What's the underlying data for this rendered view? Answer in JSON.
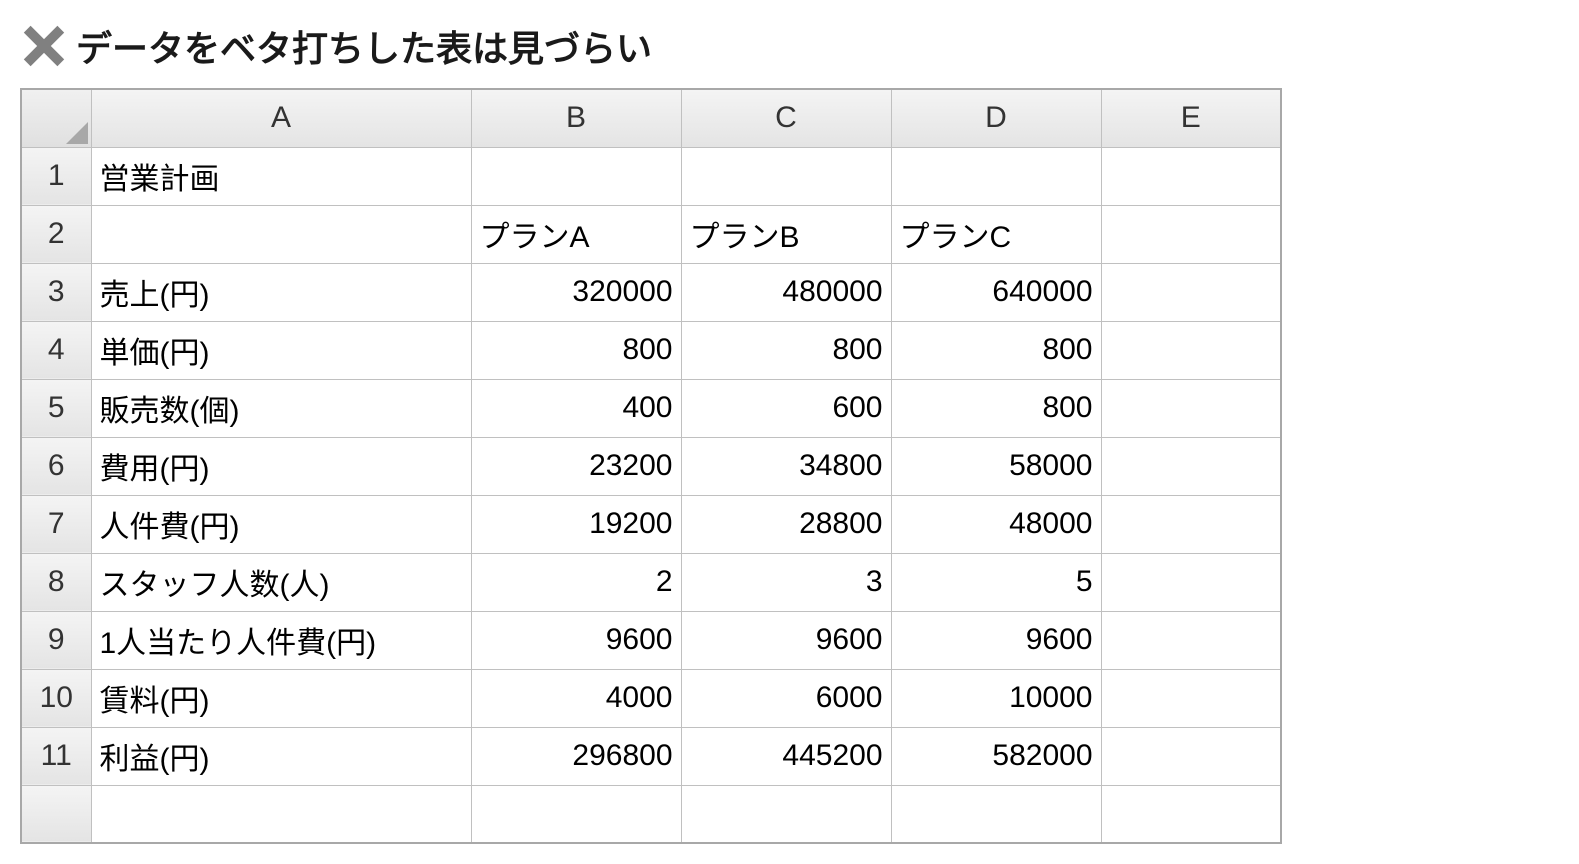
{
  "heading": {
    "text": "データをベタ打ちした表は見づらい"
  },
  "columns": [
    "A",
    "B",
    "C",
    "D",
    "E"
  ],
  "rowNumbers": [
    "1",
    "2",
    "3",
    "4",
    "5",
    "6",
    "7",
    "8",
    "9",
    "10",
    "11"
  ],
  "cells": {
    "r1": {
      "A": "営業計画",
      "B": "",
      "C": "",
      "D": "",
      "E": ""
    },
    "r2": {
      "A": "",
      "B": "プランA",
      "C": "プランB",
      "D": "プランC",
      "E": ""
    },
    "r3": {
      "A": "売上(円)",
      "B": "320000",
      "C": "480000",
      "D": "640000",
      "E": ""
    },
    "r4": {
      "A": "単価(円)",
      "B": "800",
      "C": "800",
      "D": "800",
      "E": ""
    },
    "r5": {
      "A": "販売数(個)",
      "B": "400",
      "C": "600",
      "D": "800",
      "E": ""
    },
    "r6": {
      "A": "費用(円)",
      "B": "23200",
      "C": "34800",
      "D": "58000",
      "E": ""
    },
    "r7": {
      "A": "人件費(円)",
      "B": "19200",
      "C": "28800",
      "D": "48000",
      "E": ""
    },
    "r8": {
      "A": "スタッフ人数(人)",
      "B": "2",
      "C": "3",
      "D": "5",
      "E": ""
    },
    "r9": {
      "A": "1人当たり人件費(円)",
      "B": "9600",
      "C": "9600",
      "D": "9600",
      "E": ""
    },
    "r10": {
      "A": "賃料(円)",
      "B": "4000",
      "C": "6000",
      "D": "10000",
      "E": ""
    },
    "r11": {
      "A": "利益(円)",
      "B": "296800",
      "C": "445200",
      "D": "582000",
      "E": ""
    }
  }
}
